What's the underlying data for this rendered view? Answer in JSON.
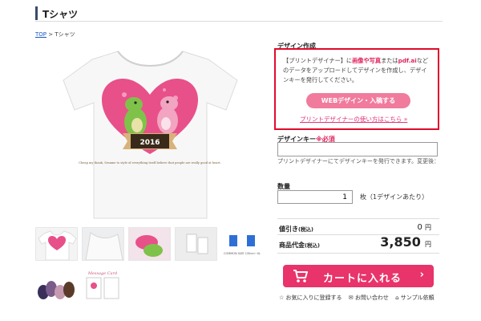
{
  "header": {
    "title": "Tシャツ"
  },
  "breadcrumb": {
    "top": "TOP",
    "separator": ">",
    "current": "Tシャツ"
  },
  "product_image": {
    "shirt_color": "#f7f7f7",
    "heart_color": "#e8508a",
    "year_label": "2016",
    "caption": "Cheap my thank, Sesame to style of everything itself believe that people are really good at heart."
  },
  "thumbnails": [
    {
      "name": "tshirt-front"
    },
    {
      "name": "tshirt-detail"
    },
    {
      "name": "print-closeup"
    },
    {
      "name": "care-label"
    },
    {
      "name": "size-chart",
      "caption": "COMMON SIZE 130cm~XL"
    },
    {
      "name": "bag-colors"
    },
    {
      "name": "message-card",
      "title": "Message Card"
    }
  ],
  "design": {
    "title": "デザイン作成",
    "desc_part1": "【プリントデザイナー】に",
    "desc_highlight1": "画像や写真",
    "desc_part2": "または",
    "desc_highlight2": "pdf.ai",
    "desc_part3": "などのデータをアップロードしてデザインを作成し、デザインキーを発行してください。",
    "web_button": "WEBデザイン・入稿する",
    "howto_link": "プリントデザイナーの使い方はこちら »"
  },
  "design_key": {
    "label": "デザインキー",
    "required": "※必須",
    "value": "",
    "help": "プリントデザイナーにてデザインキーを発行できます。変更後："
  },
  "quantity": {
    "label": "数量",
    "value": "1",
    "unit": "枚（1デザインあたり）"
  },
  "pricing": {
    "discount_label": "値引き",
    "discount_suffix": "(税込)",
    "discount_value": "0",
    "discount_unit": "円",
    "total_label": "商品代金",
    "total_suffix": "(税込)",
    "total_value": "3,850",
    "total_unit": "円"
  },
  "cart": {
    "label": "カートに入れる",
    "chevron": "›",
    "color": "#e8336b"
  },
  "links": {
    "favorite": "お気に入りに登録する",
    "inquiry": "お問い合わせ",
    "sample": "サンプル依頼"
  }
}
